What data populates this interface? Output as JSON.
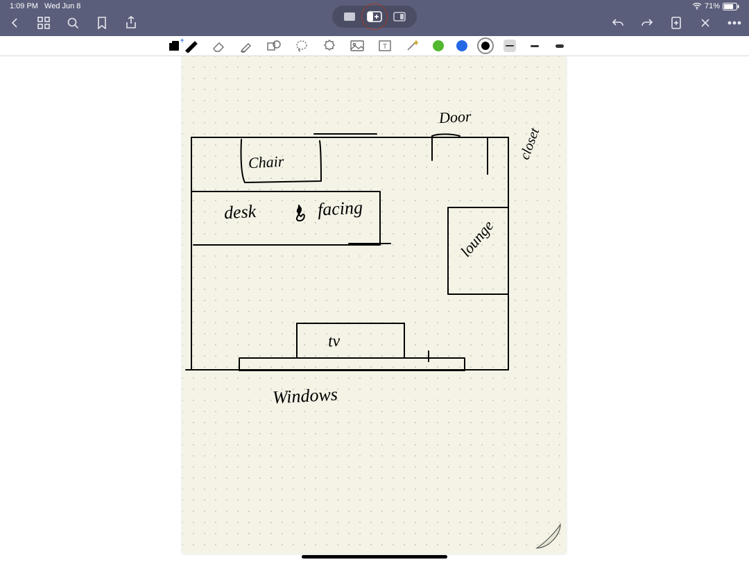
{
  "status": {
    "time": "1:09 PM",
    "date": "Wed Jun 8",
    "battery": "71%"
  },
  "colors": {
    "green": "#53b72f",
    "blue": "#2468e5",
    "black": "#000000"
  },
  "strokes": {
    "thin": 1,
    "med": 3,
    "thick": 5
  },
  "sketch": {
    "labels": {
      "door": "Door",
      "closet": "closet",
      "chair": "Chair",
      "desk": "desk",
      "facing": "facing",
      "lounge": "lounge",
      "tv": "tv",
      "windows": "Windows"
    }
  }
}
